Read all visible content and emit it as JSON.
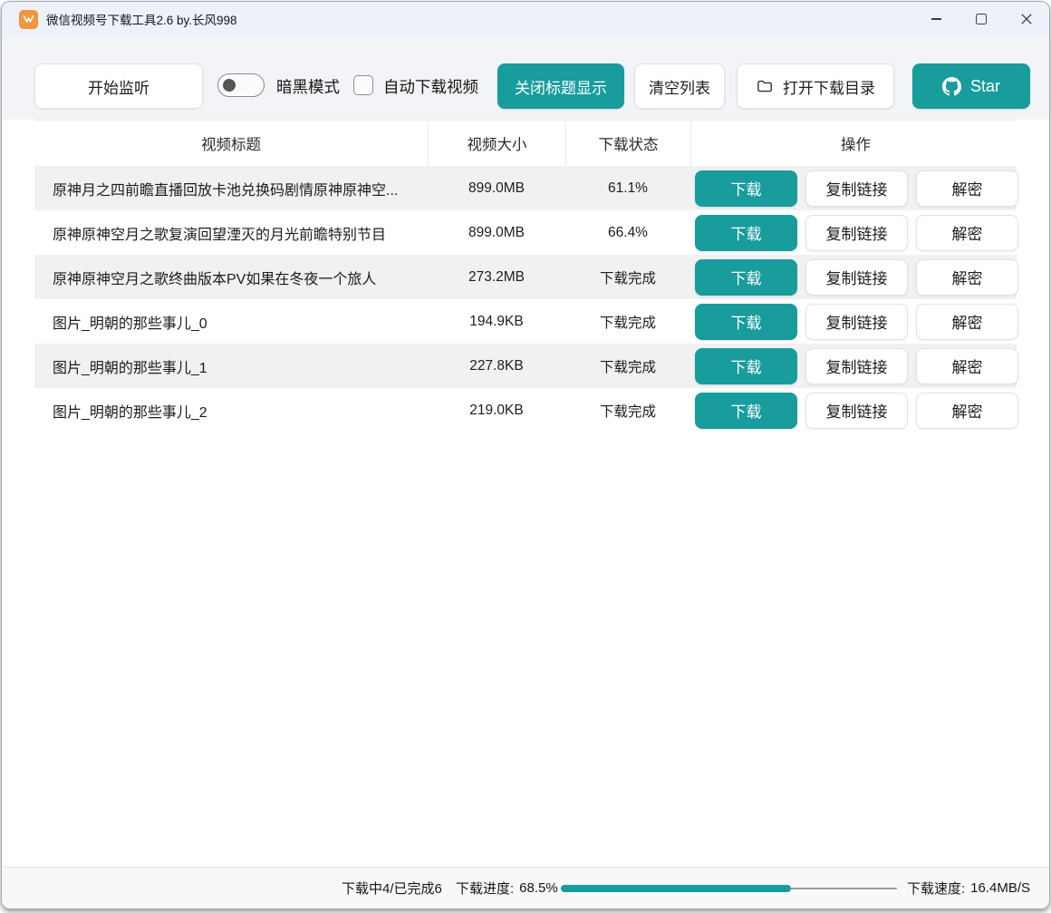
{
  "window": {
    "title": "微信视频号下载工具2.6 by.长风998"
  },
  "toolbar": {
    "start_listen_label": "开始监听",
    "dark_mode_label": "暗黑模式",
    "dark_mode_on": false,
    "auto_download_label": "自动下载视频",
    "auto_download_checked": false,
    "close_title_display_label": "关闭标题显示",
    "clear_list_label": "清空列表",
    "open_download_dir_label": "打开下载目录",
    "star_label": "Star"
  },
  "table": {
    "headers": {
      "title": "视频标题",
      "size": "视频大小",
      "status": "下载状态",
      "actions": "操作"
    },
    "row_actions": {
      "download": "下载",
      "copy_link": "复制链接",
      "decrypt": "解密"
    },
    "rows": [
      {
        "title": "原神月之四前瞻直播回放卡池兑换码剧情原神原神空...",
        "size": "899.0MB",
        "status": "61.1%"
      },
      {
        "title": "原神原神空月之歌复演回望湮灭的月光前瞻特别节目",
        "size": "899.0MB",
        "status": "66.4%"
      },
      {
        "title": "原神原神空月之歌终曲版本PV如果在冬夜一个旅人",
        "size": "273.2MB",
        "status": "下载完成"
      },
      {
        "title": "图片_明朝的那些事儿_0",
        "size": "194.9KB",
        "status": "下载完成"
      },
      {
        "title": "图片_明朝的那些事儿_1",
        "size": "227.8KB",
        "status": "下载完成"
      },
      {
        "title": "图片_明朝的那些事儿_2",
        "size": "219.0KB",
        "status": "下载完成"
      }
    ]
  },
  "footer": {
    "counts": "下载中4/已完成6",
    "progress_label": "下载进度:",
    "progress_value": "68.5%",
    "progress_percent": 68.5,
    "speed_label": "下载速度:",
    "speed_value": "16.4MB/S"
  },
  "icons": {
    "app_icon": "wechat-channels-logo",
    "folder": "folder-icon",
    "github": "github-octocat-icon"
  },
  "colors": {
    "accent_teal": "#189c9c",
    "app_icon_orange": "#f0963f"
  }
}
